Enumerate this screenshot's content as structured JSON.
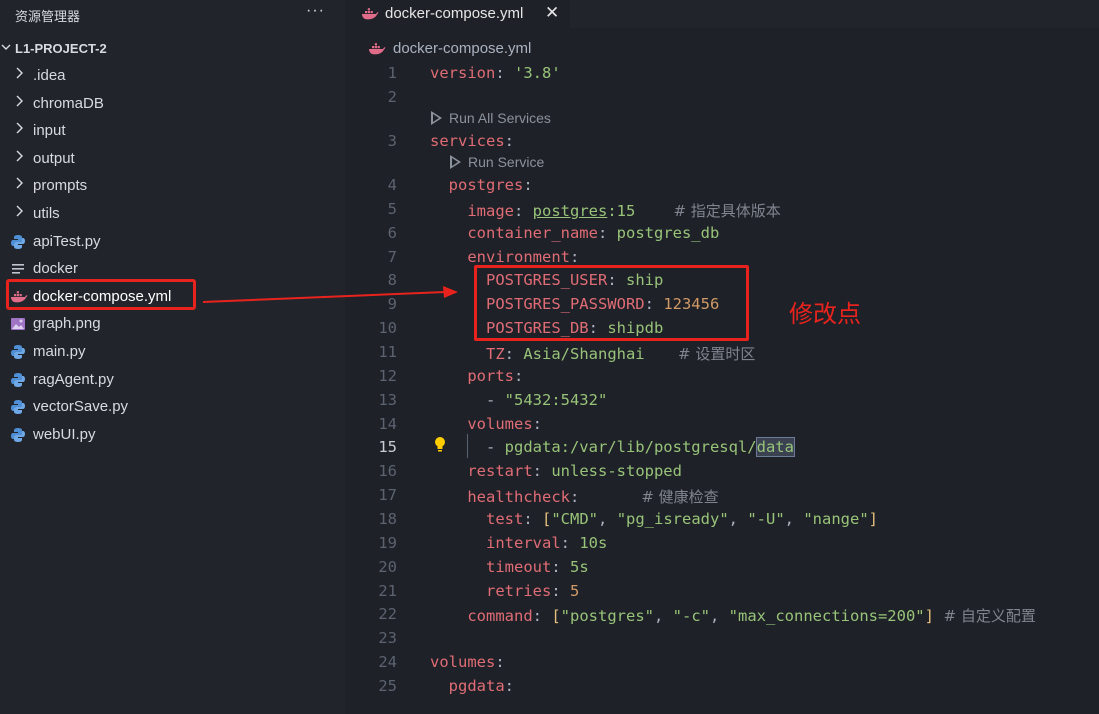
{
  "sidebar": {
    "title": "资源管理器",
    "more": "···",
    "project": "L1-PROJECT-2",
    "items": [
      {
        "label": ".idea",
        "type": "folder"
      },
      {
        "label": "chromaDB",
        "type": "folder"
      },
      {
        "label": "input",
        "type": "folder"
      },
      {
        "label": "output",
        "type": "folder"
      },
      {
        "label": "prompts",
        "type": "folder"
      },
      {
        "label": "utils",
        "type": "folder"
      },
      {
        "label": "apiTest.py",
        "type": "python"
      },
      {
        "label": "docker",
        "type": "text"
      },
      {
        "label": "docker-compose.yml",
        "type": "docker"
      },
      {
        "label": "graph.png",
        "type": "image"
      },
      {
        "label": "main.py",
        "type": "python"
      },
      {
        "label": "ragAgent.py",
        "type": "python"
      },
      {
        "label": "vectorSave.py",
        "type": "python"
      },
      {
        "label": "webUI.py",
        "type": "python"
      }
    ]
  },
  "tab": {
    "label": "docker-compose.yml",
    "close": "✕"
  },
  "breadcrumb": "docker-compose.yml",
  "codelens": {
    "run_all": "Run All Services",
    "run_service": "Run Service"
  },
  "annotation": "修改点",
  "code": {
    "l1": {
      "num": "1",
      "a": "version",
      "b": ": ",
      "c": "'3.8'"
    },
    "l2": {
      "num": "2"
    },
    "l3": {
      "num": "3",
      "a": "services",
      "b": ":"
    },
    "l4": {
      "num": "4",
      "a": "  postgres",
      "b": ":"
    },
    "l5": {
      "num": "5",
      "a": "    image",
      "b": ": ",
      "c": "postgres",
      "d": ":15",
      "cm": "        # 指定具体版本"
    },
    "l6": {
      "num": "6",
      "a": "    container_name",
      "b": ": ",
      "c": "postgres_db"
    },
    "l7": {
      "num": "7",
      "a": "    environment",
      "b": ":"
    },
    "l8": {
      "num": "8",
      "a": "      POSTGRES_USER",
      "b": ": ",
      "c": "ship"
    },
    "l9": {
      "num": "9",
      "a": "      POSTGRES_PASSWORD",
      "b": ": ",
      "c": "123456"
    },
    "l10": {
      "num": "10",
      "a": "      POSTGRES_DB",
      "b": ": ",
      "c": "shipdb"
    },
    "l11": {
      "num": "11",
      "a": "      TZ",
      "b": ": ",
      "c": "Asia/Shanghai",
      "cm": "       # 设置时区"
    },
    "l12": {
      "num": "12",
      "a": "    ports",
      "b": ":"
    },
    "l13": {
      "num": "13",
      "b": "      - ",
      "c": "\"5432:5432\""
    },
    "l14": {
      "num": "14",
      "a": "    volumes",
      "b": ":"
    },
    "l15": {
      "num": "15",
      "b": "      - ",
      "c": "pgdata:/var/lib/postgresql/",
      "d": "data"
    },
    "l16": {
      "num": "16",
      "a": "    restart",
      "b": ": ",
      "c": "unless-stopped"
    },
    "l17": {
      "num": "17",
      "a": "    healthcheck",
      "b": ":",
      "cm": "             # 健康检查"
    },
    "l18": {
      "num": "18",
      "a": "      test",
      "b": ": ",
      "b2": "[",
      "c1": "\"CMD\"",
      "c2": "\"pg_isready\"",
      "c3": "\"-U\"",
      "c4": "\"nange\"",
      "b3": "]",
      "sep": ", "
    },
    "l19": {
      "num": "19",
      "a": "      interval",
      "b": ": ",
      "c": "10s"
    },
    "l20": {
      "num": "20",
      "a": "      timeout",
      "b": ": ",
      "c": "5s"
    },
    "l21": {
      "num": "21",
      "a": "      retries",
      "b": ": ",
      "c": "5"
    },
    "l22": {
      "num": "22",
      "a": "    command",
      "b": ": ",
      "b2": "[",
      "c1": "\"postgres\"",
      "c2": "\"-c\"",
      "c3": "\"max_connections=200\"",
      "b3": "]",
      "sep": ", ",
      "cm": "  # 自定义配置"
    },
    "l23": {
      "num": "23"
    },
    "l24": {
      "num": "24",
      "a": "volumes",
      "b": ":"
    },
    "l25": {
      "num": "25",
      "a": "  pgdata",
      "b": ":"
    }
  },
  "colors": {
    "annotation_red": "#e8231d",
    "key": "#e06c75",
    "string": "#98c379",
    "number": "#d19a66"
  }
}
